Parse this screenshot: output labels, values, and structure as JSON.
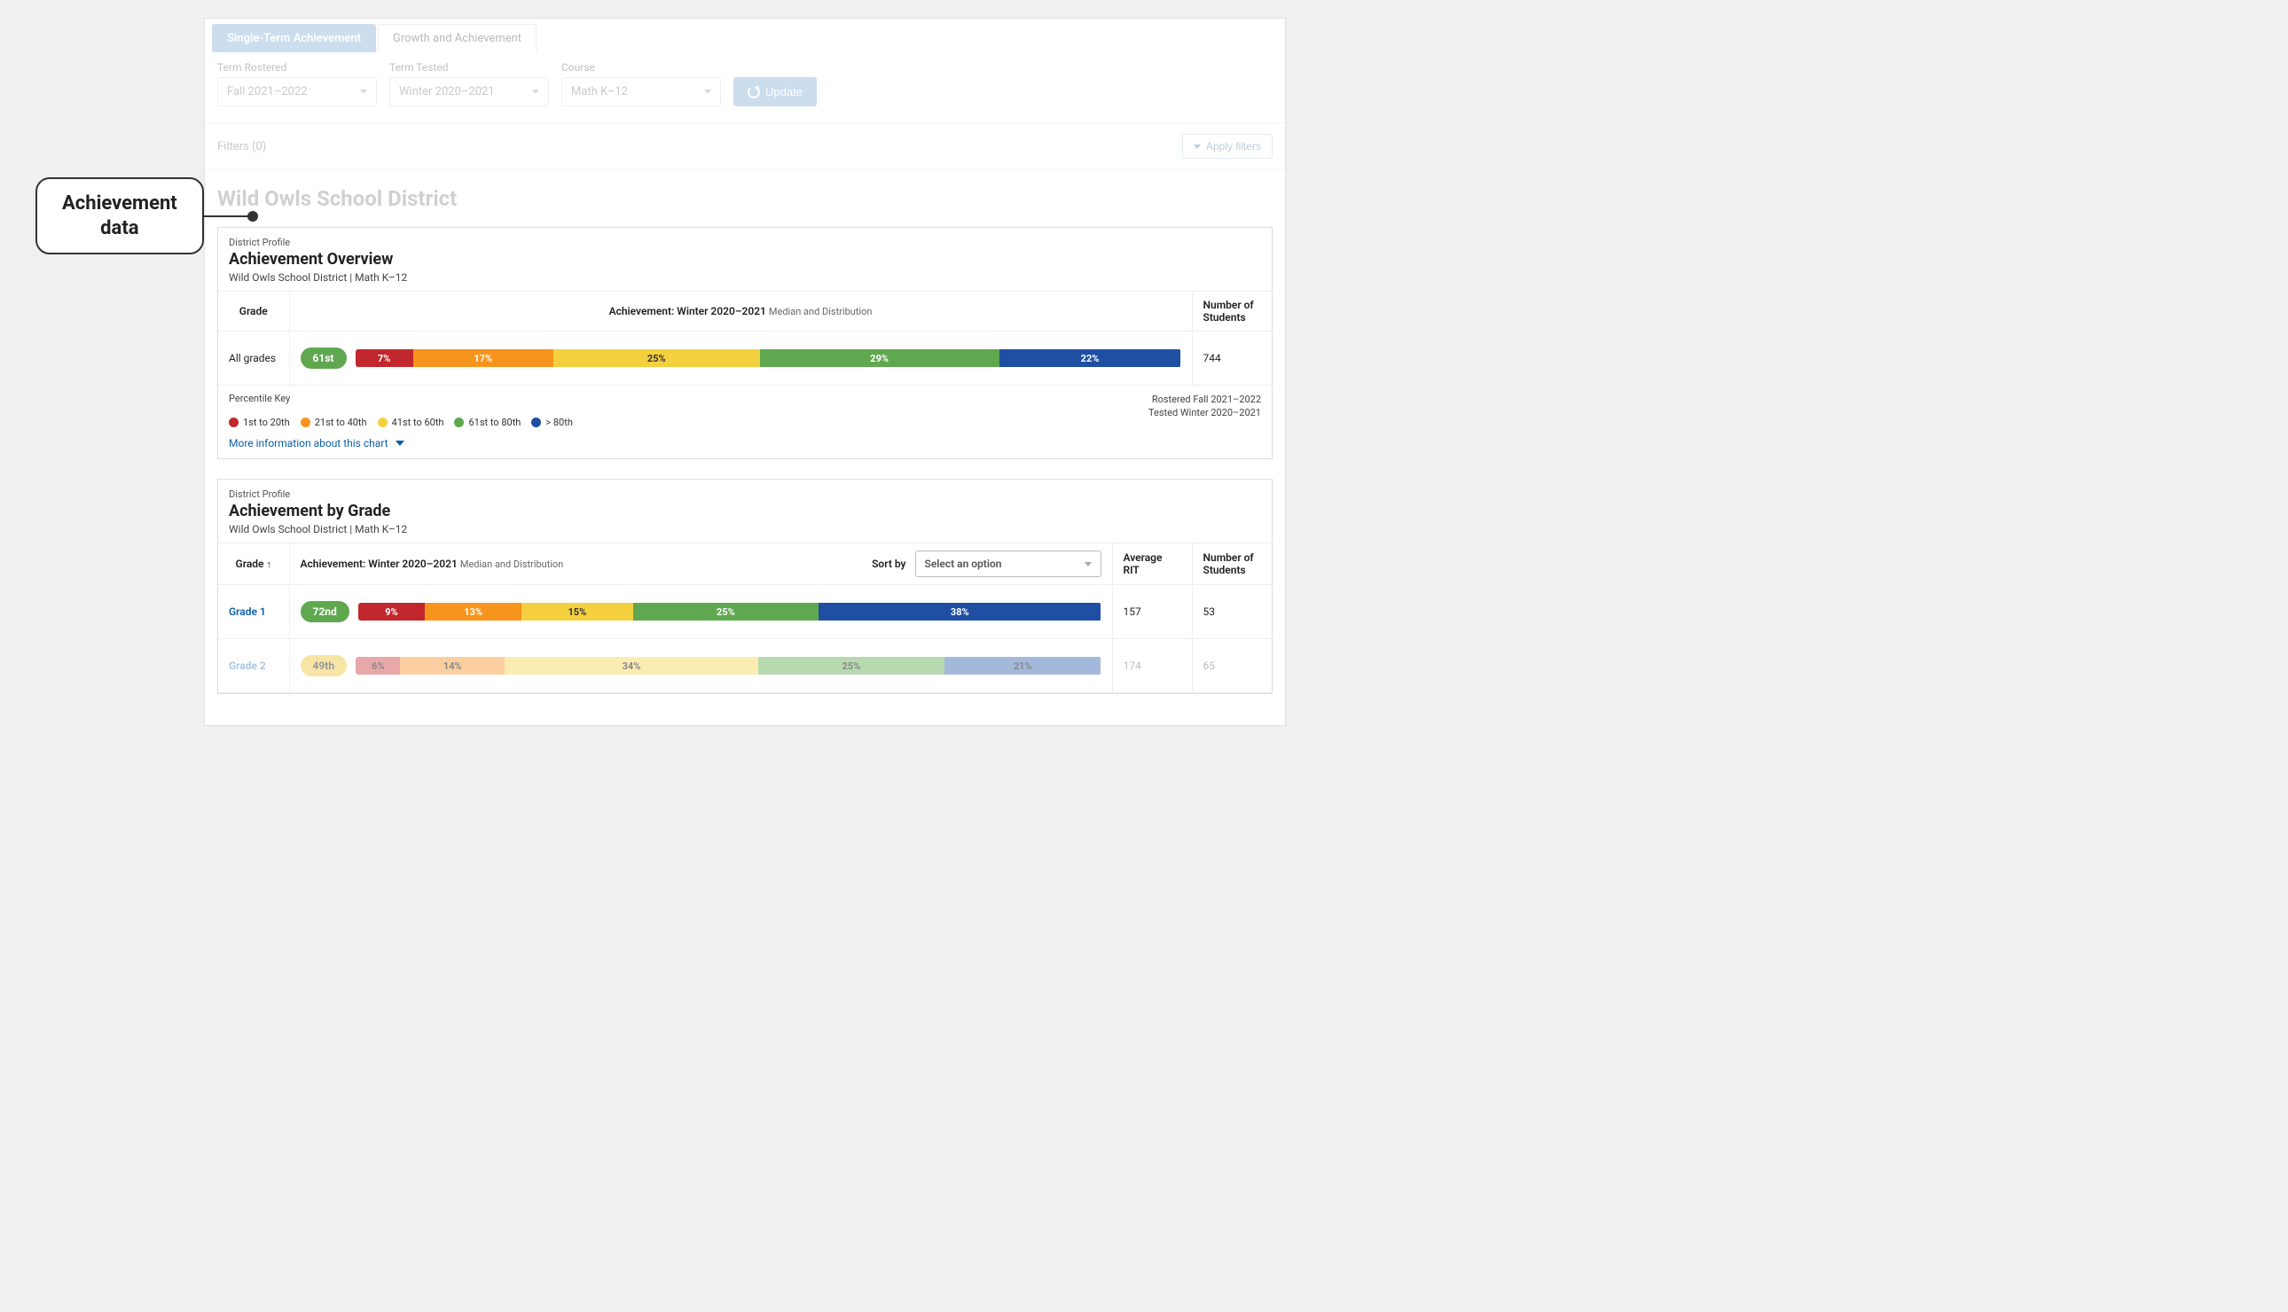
{
  "callout": {
    "line1": "Achievement",
    "line2": "data"
  },
  "tabs": {
    "active": "Single-Term Achievement",
    "inactive": "Growth and Achievement"
  },
  "controls": {
    "term_rostered": {
      "label": "Term Rostered",
      "value": "Fall 2021–2022"
    },
    "term_tested": {
      "label": "Term Tested",
      "value": "Winter 2020–2021"
    },
    "course": {
      "label": "Course",
      "value": "Math K–12"
    },
    "update_label": "Update"
  },
  "filters": {
    "label": "Filters",
    "count": "(0)",
    "apply": "Apply filters"
  },
  "page_title": "Wild Owls School District",
  "overview": {
    "eyebrow": "District Profile",
    "title": "Achievement Overview",
    "sub": "Wild Owls School District  |  Math K–12",
    "col_grade": "Grade",
    "col_ach_title": "Achievement: Winter 2020–2021",
    "col_ach_sub": "Median and Distribution",
    "col_num_l1": "Number of",
    "col_num_l2": "Students",
    "row": {
      "grade": "All grades",
      "pill": "61st",
      "segs": [
        {
          "label": "7%",
          "w": 7,
          "cls": "c-red"
        },
        {
          "label": "17%",
          "w": 17,
          "cls": "c-orange"
        },
        {
          "label": "25%",
          "w": 25,
          "cls": "c-yellow"
        },
        {
          "label": "29%",
          "w": 29,
          "cls": "c-green"
        },
        {
          "label": "22%",
          "w": 22,
          "cls": "c-blue"
        }
      ],
      "num": "744"
    },
    "legend": {
      "title": "Percentile Key",
      "items": [
        {
          "cls": "c-red",
          "label": "1st to 20th"
        },
        {
          "cls": "c-orange",
          "label": "21st to 40th"
        },
        {
          "cls": "c-yellow",
          "label": "41st to 60th"
        },
        {
          "cls": "c-green",
          "label": "61st to 80th"
        },
        {
          "cls": "c-blue",
          "label": "> 80th"
        }
      ],
      "right_l1": "Rostered Fall 2021–2022",
      "right_l2": "Tested Winter 2020–2021"
    },
    "more_info": "More information about this chart"
  },
  "bygrade": {
    "eyebrow": "District Profile",
    "title": "Achievement by Grade",
    "sub": "Wild Owls School District  |  Math K–12",
    "col_grade": "Grade",
    "sort_arrow": "↑",
    "col_ach_title": "Achievement: Winter 2020–2021",
    "col_ach_sub": "Median and Distribution",
    "sort_by": "Sort by",
    "sort_placeholder": "Select an option",
    "col_avg_l1": "Average",
    "col_avg_l2": "RIT",
    "col_num_l1": "Number of",
    "col_num_l2": "Students",
    "rows": [
      {
        "grade": "Grade 1",
        "pill": "72nd",
        "pill_cls": "",
        "faded": false,
        "segs": [
          {
            "label": "9%",
            "w": 9,
            "cls": "c-red"
          },
          {
            "label": "13%",
            "w": 13,
            "cls": "c-orange"
          },
          {
            "label": "15%",
            "w": 15,
            "cls": "c-yellow"
          },
          {
            "label": "25%",
            "w": 25,
            "cls": "c-green"
          },
          {
            "label": "38%",
            "w": 38,
            "cls": "c-blue"
          }
        ],
        "avg": "157",
        "num": "53"
      },
      {
        "grade": "Grade 2",
        "pill": "49th",
        "pill_cls": "yellow",
        "faded": true,
        "segs": [
          {
            "label": "6%",
            "w": 6,
            "cls": "c-red"
          },
          {
            "label": "14%",
            "w": 14,
            "cls": "c-orange"
          },
          {
            "label": "34%",
            "w": 34,
            "cls": "c-yellow"
          },
          {
            "label": "25%",
            "w": 25,
            "cls": "c-green"
          },
          {
            "label": "21%",
            "w": 21,
            "cls": "c-blue"
          }
        ],
        "avg": "174",
        "num": "65"
      }
    ]
  },
  "chart_data": {
    "type": "bar",
    "title": "Achievement: Winter 2020–2021 — Median and Distribution",
    "unit": "percent",
    "legend": [
      {
        "name": "1st to 20th",
        "color": "#c1272d"
      },
      {
        "name": "21st to 40th",
        "color": "#f7941d"
      },
      {
        "name": "41st to 60th",
        "color": "#f4d03f"
      },
      {
        "name": "61st to 80th",
        "color": "#5fa84f"
      },
      {
        "name": "> 80th",
        "color": "#1e4fa3"
      }
    ],
    "rows": [
      {
        "group": "All grades",
        "median_percentile": 61,
        "distribution": [
          7,
          17,
          25,
          29,
          22
        ],
        "students": 744
      },
      {
        "group": "Grade 1",
        "median_percentile": 72,
        "distribution": [
          9,
          13,
          15,
          25,
          38
        ],
        "avg_rit": 157,
        "students": 53
      },
      {
        "group": "Grade 2",
        "median_percentile": 49,
        "distribution": [
          6,
          14,
          34,
          25,
          21
        ],
        "avg_rit": 174,
        "students": 65
      }
    ]
  }
}
